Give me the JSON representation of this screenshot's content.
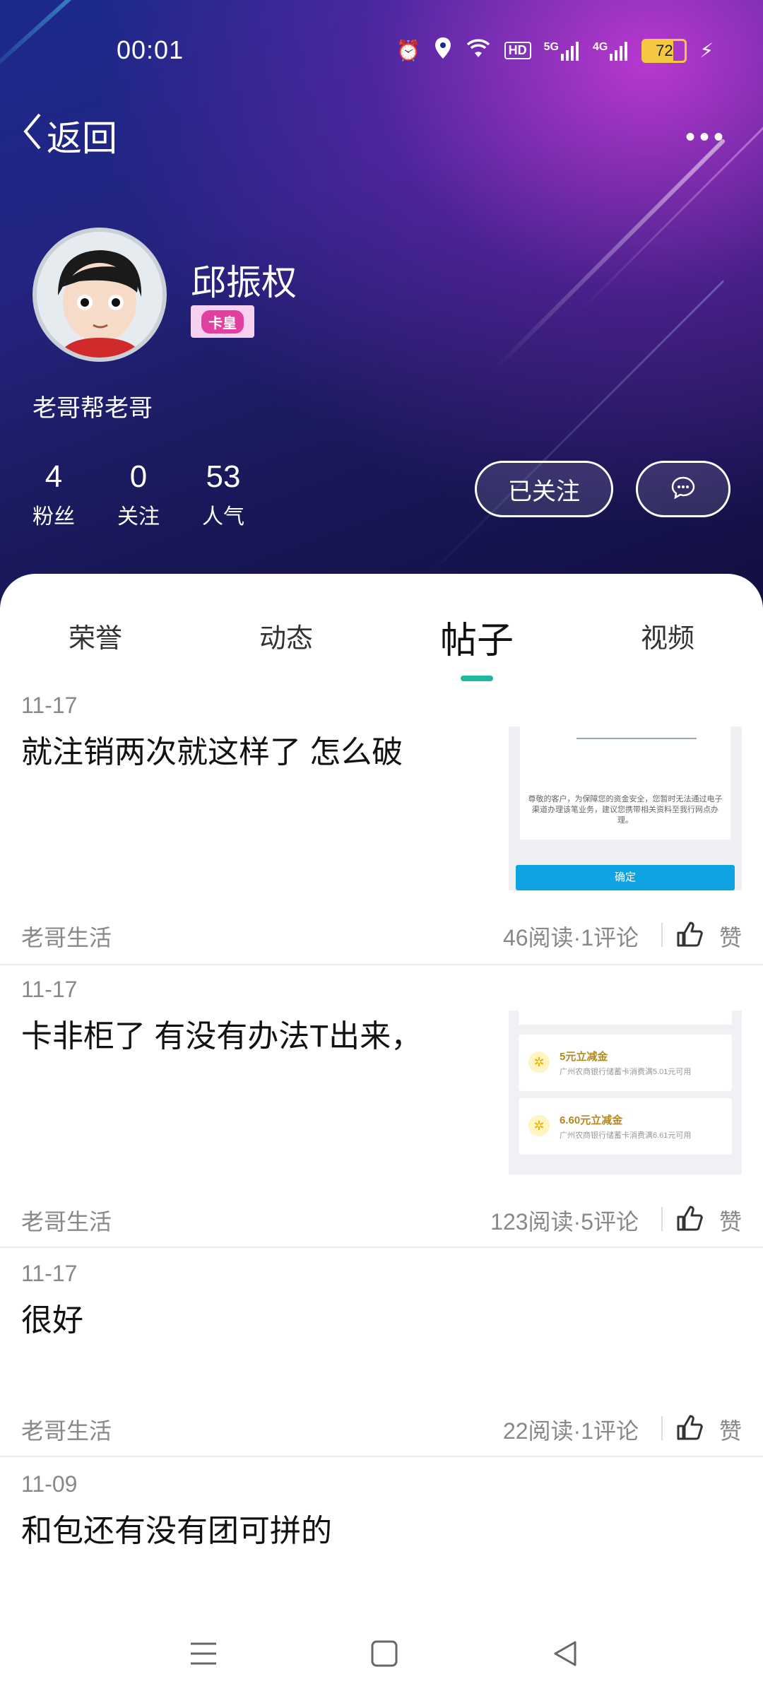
{
  "status_bar": {
    "time": "00:01",
    "network_5g": "5G",
    "network_4g": "4G",
    "hd": "HD",
    "battery": "72"
  },
  "nav": {
    "back_label": "返回",
    "more_label": "•••"
  },
  "profile": {
    "name": "邱振权",
    "badge": "卡皇",
    "bio": "老哥帮老哥",
    "stats": [
      {
        "num": "4",
        "label": "粉丝"
      },
      {
        "num": "0",
        "label": "关注"
      },
      {
        "num": "53",
        "label": "人气"
      }
    ],
    "follow_label": "已关注"
  },
  "tabs": [
    {
      "label": "荣誉",
      "active": false
    },
    {
      "label": "动态",
      "active": false
    },
    {
      "label": "帖子",
      "active": true
    },
    {
      "label": "视频",
      "active": false
    }
  ],
  "posts": [
    {
      "date": "11-17",
      "title": "就注销两次就这样了 怎么破",
      "category": "老哥生活",
      "meta": "46阅读·1评论",
      "like": "赞",
      "thumb_text": "尊敬的客户，为保障您的资金安全，您暂时无法通过电子渠道办理该笔业务，建议您携带相关资料至我行网点办理。",
      "thumb_button": "确定"
    },
    {
      "date": "11-17",
      "title": "卡非柜了  有没有办法T出来，",
      "category": "老哥生活",
      "meta": "123阅读·5评论",
      "like": "赞",
      "coupons": [
        {
          "title": "5元立减金",
          "desc": "广州农商银行储蓄卡消费满5.01元可用"
        },
        {
          "title": "6.60元立减金",
          "desc": "广州农商银行储蓄卡消费满6.61元可用"
        }
      ]
    },
    {
      "date": "11-17",
      "title": "很好",
      "category": "老哥生活",
      "meta": "22阅读·1评论",
      "like": "赞"
    },
    {
      "date": "11-09",
      "title": "和包还有没有团可拼的"
    }
  ],
  "colors": {
    "accent": "#1fb89b",
    "hero_dark": "#1a1a5e",
    "hero_magenta": "#d23cdc"
  }
}
